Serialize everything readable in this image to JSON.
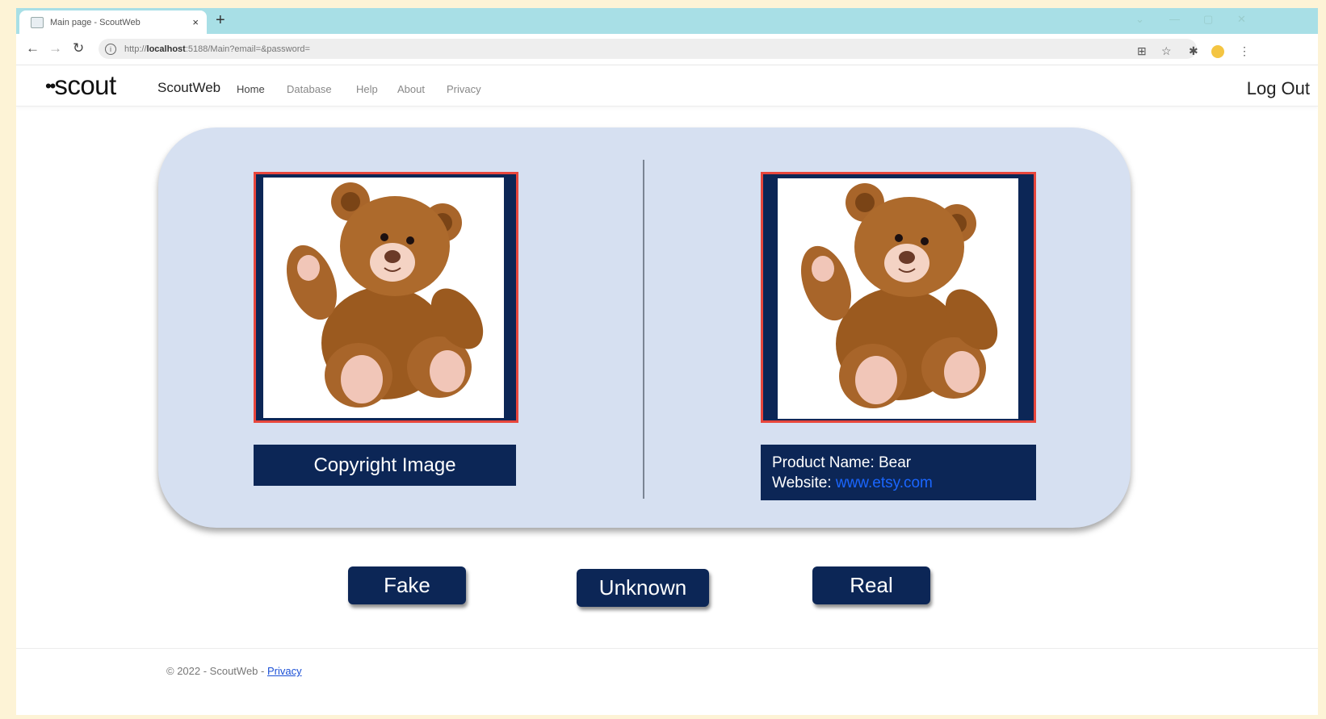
{
  "browser": {
    "tab_title": "Main page - ScoutWeb",
    "tab_close": "×",
    "new_tab": "+",
    "url_prefix": "http://",
    "url_host": "localhost",
    "url_rest": ":5188/Main?email=&password="
  },
  "navbar": {
    "logo": "scout",
    "brand": "ScoutWeb",
    "links": [
      "Home",
      "Database",
      "Help",
      "About",
      "Privacy"
    ],
    "logout": "Log Out"
  },
  "comparison": {
    "left_caption": "Copyright Image",
    "product_name_label": "Product Name: Bear",
    "website_label": "Website:",
    "website_link": "www.etsy.com",
    "image_subject": "teddy-bear"
  },
  "actions": {
    "fake": "Fake",
    "unknown": "Unknown",
    "real": "Real"
  },
  "footer": {
    "copyright": "© 2022 - ScoutWeb - ",
    "privacy": "Privacy"
  },
  "colors": {
    "navy": "#0c2656",
    "panel": "#d6e0f1",
    "frame_border": "#e8463c",
    "link": "#1a66ff"
  }
}
